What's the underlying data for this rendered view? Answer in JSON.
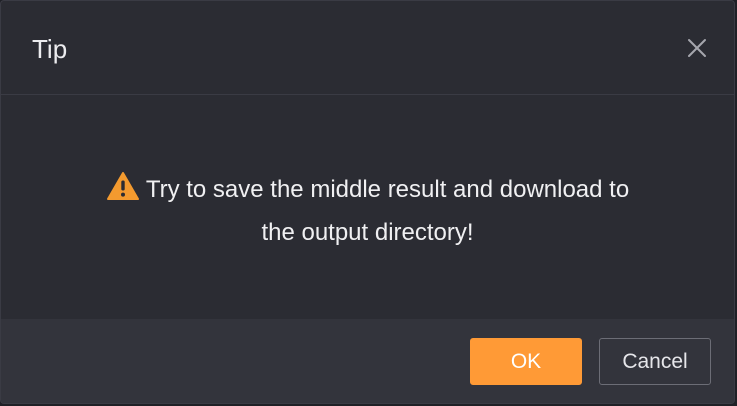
{
  "dialog": {
    "title": "Tip",
    "close_icon": "close-icon",
    "message": {
      "icon": "warning-icon",
      "line1": "Try to save the middle result and download to",
      "line2": "the output directory!"
    },
    "buttons": {
      "ok_label": "OK",
      "cancel_label": "Cancel"
    }
  },
  "colors": {
    "background": "#2b2c33",
    "footer": "#33343c",
    "accent": "#ff9a36",
    "warning": "#f39a2f"
  }
}
